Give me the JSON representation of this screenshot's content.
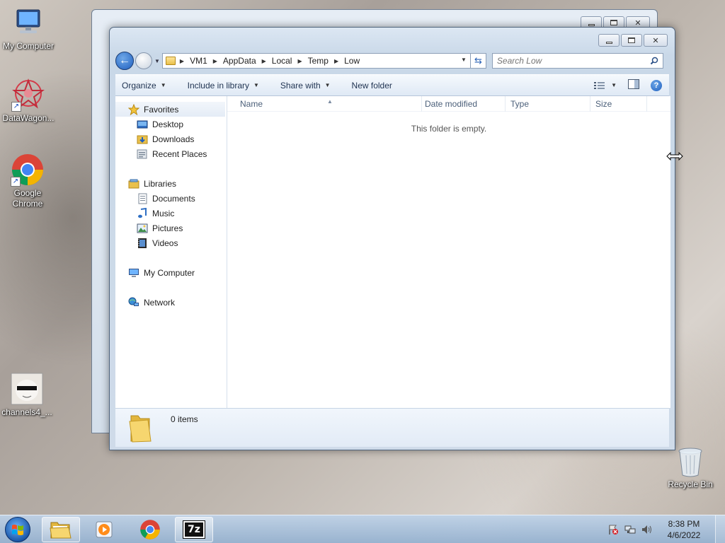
{
  "desktop": {
    "icons": [
      {
        "label": "My Computer",
        "icon": "computer-icon"
      },
      {
        "label": "DataWagon...",
        "icon": "datawagon-icon"
      },
      {
        "label": "Google Chrome",
        "icon": "chrome-icon"
      },
      {
        "label": "channels4_...",
        "icon": "image-file-icon"
      },
      {
        "label": "Recycle Bin",
        "icon": "recycle-bin-icon"
      }
    ]
  },
  "explorer": {
    "breadcrumb": [
      "VM1",
      "AppData",
      "Local",
      "Temp",
      "Low"
    ],
    "search_placeholder": "Search Low",
    "toolbar": {
      "organize": "Organize",
      "include_in_library": "Include in library",
      "share_with": "Share with",
      "new_folder": "New folder"
    },
    "nav": {
      "favorites": "Favorites",
      "favorites_items": [
        "Desktop",
        "Downloads",
        "Recent Places"
      ],
      "libraries": "Libraries",
      "libraries_items": [
        "Documents",
        "Music",
        "Pictures",
        "Videos"
      ],
      "my_computer": "My Computer",
      "network": "Network"
    },
    "columns": [
      "Name",
      "Date modified",
      "Type",
      "Size"
    ],
    "empty_message": "This folder is empty.",
    "item_count": "0 items"
  },
  "taskbar": {
    "time": "8:38 PM",
    "date": "4/6/2022",
    "tasks": [
      {
        "name": "explorer",
        "icon": "folder-icon",
        "active": true
      },
      {
        "name": "media-player",
        "icon": "media-player-icon",
        "active": false
      },
      {
        "name": "chrome",
        "icon": "chrome-icon",
        "active": false
      },
      {
        "name": "7zip",
        "icon": "7zip-icon",
        "label": "7z",
        "active": false
      }
    ]
  },
  "colors": {
    "accent": "#1f5fbf",
    "window_frame": "#c9d8e8",
    "folder_yellow": "#e9c04b"
  }
}
